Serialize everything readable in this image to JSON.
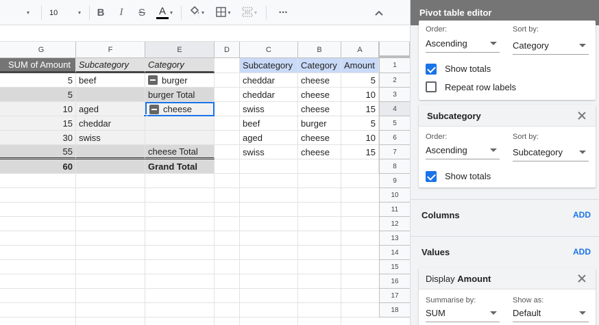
{
  "toolbar": {
    "font_size": "10",
    "bold": "B",
    "italic": "I",
    "strike": "S",
    "text_color": "A",
    "more": "···"
  },
  "colors": {
    "accent": "#1a73e8",
    "header_blue": "#c9daf8",
    "gray_row": "#d9d9d9",
    "editor_title_bg": "#757575"
  },
  "columns": [
    "G",
    "F",
    "E",
    "D",
    "C",
    "B",
    "A"
  ],
  "rows": [
    "1",
    "2",
    "3",
    "4",
    "5",
    "6",
    "7",
    "8",
    "9",
    "10",
    "11",
    "12",
    "13",
    "14",
    "15",
    "16",
    "17",
    "18"
  ],
  "pivot": {
    "h_sum": "SUM of Amount",
    "h_sub": "Subcategory",
    "h_cat": "Category",
    "r2": {
      "g": "5",
      "f": "beef",
      "e": "burger"
    },
    "r3": {
      "g": "5",
      "f": "",
      "e": "burger Total"
    },
    "r4": {
      "g": "10",
      "f": "aged",
      "e": "cheese"
    },
    "r5": {
      "g": "15",
      "f": "cheddar",
      "e": ""
    },
    "r6": {
      "g": "30",
      "f": "swiss",
      "e": ""
    },
    "r7": {
      "g": "55",
      "f": "",
      "e": "cheese Total"
    },
    "r8": {
      "g": "60",
      "f": "",
      "e": "Grand Total"
    }
  },
  "source": {
    "h_sub": "Subcategory",
    "h_cat": "Category",
    "h_amt": "Amount",
    "r2": {
      "c": "cheddar",
      "b": "cheese",
      "a": "5"
    },
    "r3": {
      "c": "cheddar",
      "b": "cheese",
      "a": "10"
    },
    "r4": {
      "c": "swiss",
      "b": "cheese",
      "a": "15"
    },
    "r5": {
      "c": "beef",
      "b": "burger",
      "a": "5"
    },
    "r6": {
      "c": "aged",
      "b": "cheese",
      "a": "10"
    },
    "r7": {
      "c": "swiss",
      "b": "cheese",
      "a": "15"
    }
  },
  "editor": {
    "title": "Pivot table editor",
    "card1": {
      "order_label": "Order:",
      "order_value": "Ascending",
      "sort_label": "Sort by:",
      "sort_value": "Category",
      "show_totals": "Show totals",
      "repeat_labels": "Repeat row labels"
    },
    "card2": {
      "title": "Subcategory",
      "order_label": "Order:",
      "order_value": "Ascending",
      "sort_label": "Sort by:",
      "sort_value": "Subcategory",
      "show_totals": "Show totals"
    },
    "columns_label": "Columns",
    "columns_add": "ADD",
    "values_label": "Values",
    "values_add": "ADD",
    "card3": {
      "title_prefix": "Display",
      "title_field": "Amount",
      "summarise_label": "Summarise by:",
      "summarise_value": "SUM",
      "show_as_label": "Show as:",
      "show_as_value": "Default"
    }
  }
}
